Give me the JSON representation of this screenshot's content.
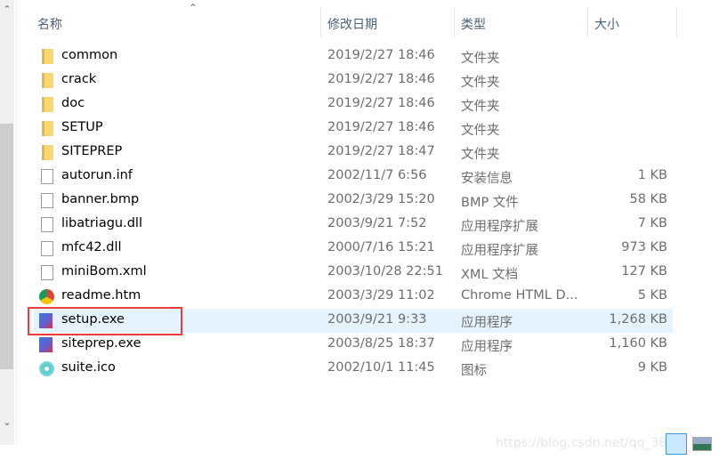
{
  "columns": {
    "name": "名称",
    "modified": "修改日期",
    "type": "类型",
    "size": "大小"
  },
  "files": [
    {
      "name": "common",
      "modified": "2019/2/27 18:46",
      "type": "文件夹",
      "size": "",
      "icon": "folder-icon"
    },
    {
      "name": "crack",
      "modified": "2019/2/27 18:46",
      "type": "文件夹",
      "size": "",
      "icon": "folder-icon"
    },
    {
      "name": "doc",
      "modified": "2019/2/27 18:46",
      "type": "文件夹",
      "size": "",
      "icon": "folder-icon"
    },
    {
      "name": "SETUP",
      "modified": "2019/2/27 18:46",
      "type": "文件夹",
      "size": "",
      "icon": "folder-icon"
    },
    {
      "name": "SITEPREP",
      "modified": "2019/2/27 18:47",
      "type": "文件夹",
      "size": "",
      "icon": "folder-icon"
    },
    {
      "name": "autorun.inf",
      "modified": "2002/11/7 6:56",
      "type": "安装信息",
      "size": "1 KB",
      "icon": "settings-file-icon"
    },
    {
      "name": "banner.bmp",
      "modified": "2002/3/29 15:20",
      "type": "BMP 文件",
      "size": "58 KB",
      "icon": "image-file-icon"
    },
    {
      "name": "libatriagu.dll",
      "modified": "2003/9/21 7:52",
      "type": "应用程序扩展",
      "size": "7 KB",
      "icon": "dll-file-icon"
    },
    {
      "name": "mfc42.dll",
      "modified": "2000/7/16 15:21",
      "type": "应用程序扩展",
      "size": "973 KB",
      "icon": "dll-file-icon"
    },
    {
      "name": "miniBom.xml",
      "modified": "2003/10/28 22:51",
      "type": "XML 文档",
      "size": "127 KB",
      "icon": "file-icon"
    },
    {
      "name": "readme.htm",
      "modified": "2003/3/29 11:02",
      "type": "Chrome HTML D...",
      "size": "5 KB",
      "icon": "chrome-icon"
    },
    {
      "name": "setup.exe",
      "modified": "2003/9/21 9:33",
      "type": "应用程序",
      "size": "1,268 KB",
      "icon": "installer-icon",
      "selected": true
    },
    {
      "name": "siteprep.exe",
      "modified": "2003/8/25 18:37",
      "type": "应用程序",
      "size": "1,160 KB",
      "icon": "installer-icon"
    },
    {
      "name": "suite.ico",
      "modified": "2002/10/1 11:45",
      "type": "图标",
      "size": "9 KB",
      "icon": "disc-icon"
    }
  ],
  "watermark": "https://blog.csdn.net/qq_38",
  "colors": {
    "selection": "#e5f3ff",
    "highlight_box": "#f03b3b"
  }
}
